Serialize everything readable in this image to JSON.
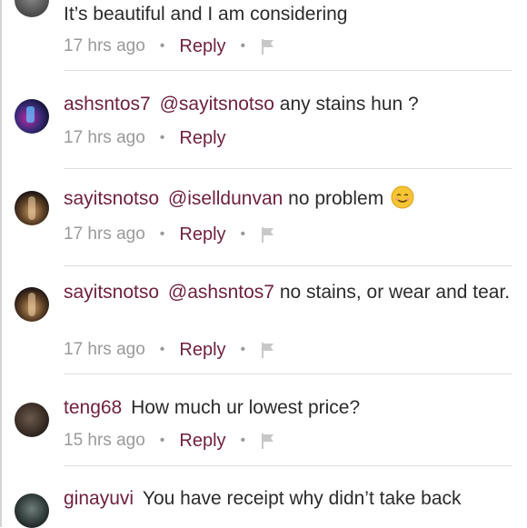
{
  "comments": [
    {
      "avatar": "user-avatar-photo",
      "username": "",
      "mention": "",
      "text": "It’s beautiful and I am considering",
      "time": "17 hrs ago",
      "reply": "Reply",
      "has_flag": true
    },
    {
      "avatar": "user-avatar-photo",
      "username": "ashsntos7",
      "mention": "@sayitsnotso",
      "text": "any stains hun ?",
      "time": "17 hrs ago",
      "reply": "Reply",
      "has_flag": false
    },
    {
      "avatar": "user-avatar-photo",
      "username": "sayitsnotso",
      "mention": "@iselldunvan",
      "text": "no problem",
      "emoji": "relieved-smile-emoji",
      "time": "17 hrs ago",
      "reply": "Reply",
      "has_flag": true
    },
    {
      "avatar": "user-avatar-photo",
      "username": "sayitsnotso",
      "mention": "@ashsntos7",
      "text": "no stains, or wear and tear.",
      "time": "17 hrs ago",
      "reply": "Reply",
      "has_flag": true
    },
    {
      "avatar": "user-avatar-photo",
      "username": "teng68",
      "mention": "",
      "text": "How much ur lowest price?",
      "time": "15 hrs ago",
      "reply": "Reply",
      "has_flag": true
    },
    {
      "avatar": "user-avatar-photo",
      "username": "ginayuvi",
      "mention": "",
      "text": "You have receipt  why didn’t take back",
      "time": "",
      "reply": "",
      "has_flag": false
    }
  ],
  "colors": {
    "accent": "#6e1f3f",
    "meta_gray": "#9a9a9a",
    "divider": "#dedede"
  }
}
